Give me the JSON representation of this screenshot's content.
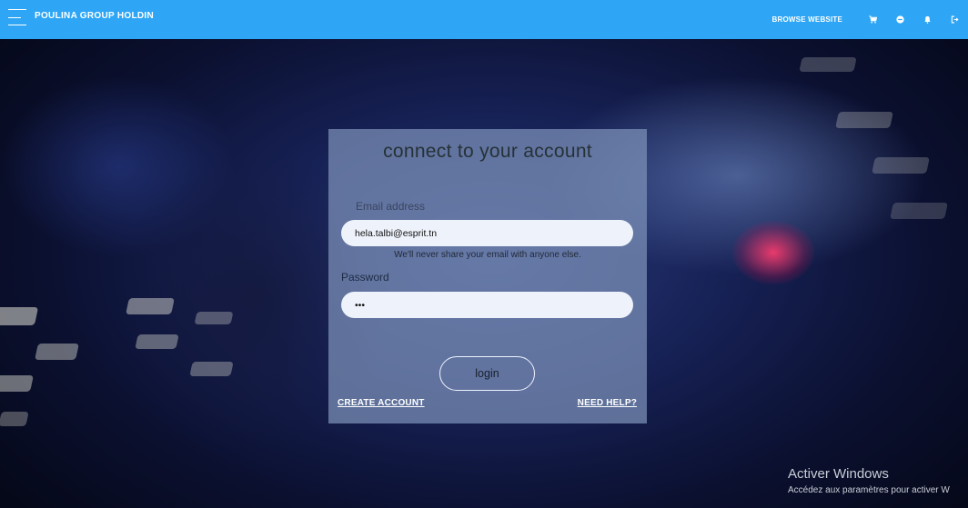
{
  "navbar": {
    "brand": "POULINA GROUP HOLDIN",
    "browse_label": "BROWSE WEBSITE",
    "icons": [
      "cart-icon",
      "minus-circle-icon",
      "bell-icon",
      "logout-icon"
    ]
  },
  "login": {
    "title": "connect to your account",
    "email_label": "Email address",
    "email_value": "hela.talbi@esprit.tn",
    "email_hint": "We'll never share your email with anyone else.",
    "password_label": "Password",
    "password_value": "•••",
    "login_button": "login",
    "create_account_link": "CREATE ACCOUNT",
    "need_help_link": "NEED HELP?"
  },
  "windows_watermark": {
    "line1": "Activer Windows",
    "line2": "Accédez aux paramètres pour activer W"
  },
  "colors": {
    "navbar": "#2ea6f5",
    "card": "#7d91b9"
  }
}
